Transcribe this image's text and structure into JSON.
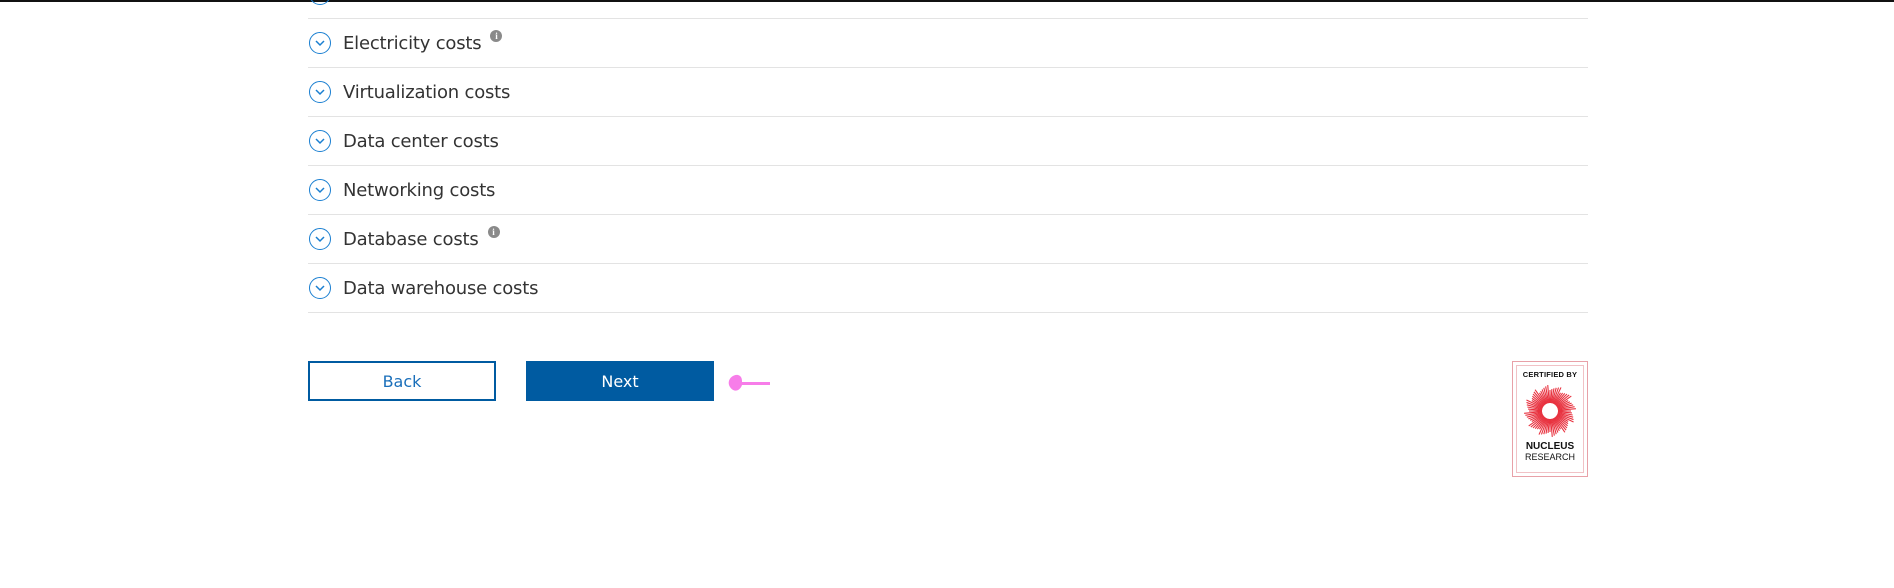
{
  "cost_sections": [
    {
      "label": ""
    },
    {
      "label": "Electricity costs",
      "info": true
    },
    {
      "label": "Virtualization costs",
      "info": false
    },
    {
      "label": "Data center costs",
      "info": false
    },
    {
      "label": "Networking costs",
      "info": false
    },
    {
      "label": "Database costs",
      "info": true
    },
    {
      "label": "Data warehouse costs",
      "info": false
    }
  ],
  "icons": {
    "expand": "chevron-down-icon",
    "info": "info-icon",
    "pointer": "pointing-hand-icon"
  },
  "info_glyph": "i",
  "buttons": {
    "back_label": "Back",
    "next_label": "Next"
  },
  "badge": {
    "certified_by": "CERTIFIED BY",
    "line1": "NUCLEUS",
    "line2": "RESEARCH"
  },
  "colors": {
    "accent": "#005ba1",
    "chevron": "#1a7fd1",
    "pointer": "#f77de9",
    "badge": "#e8323f"
  }
}
